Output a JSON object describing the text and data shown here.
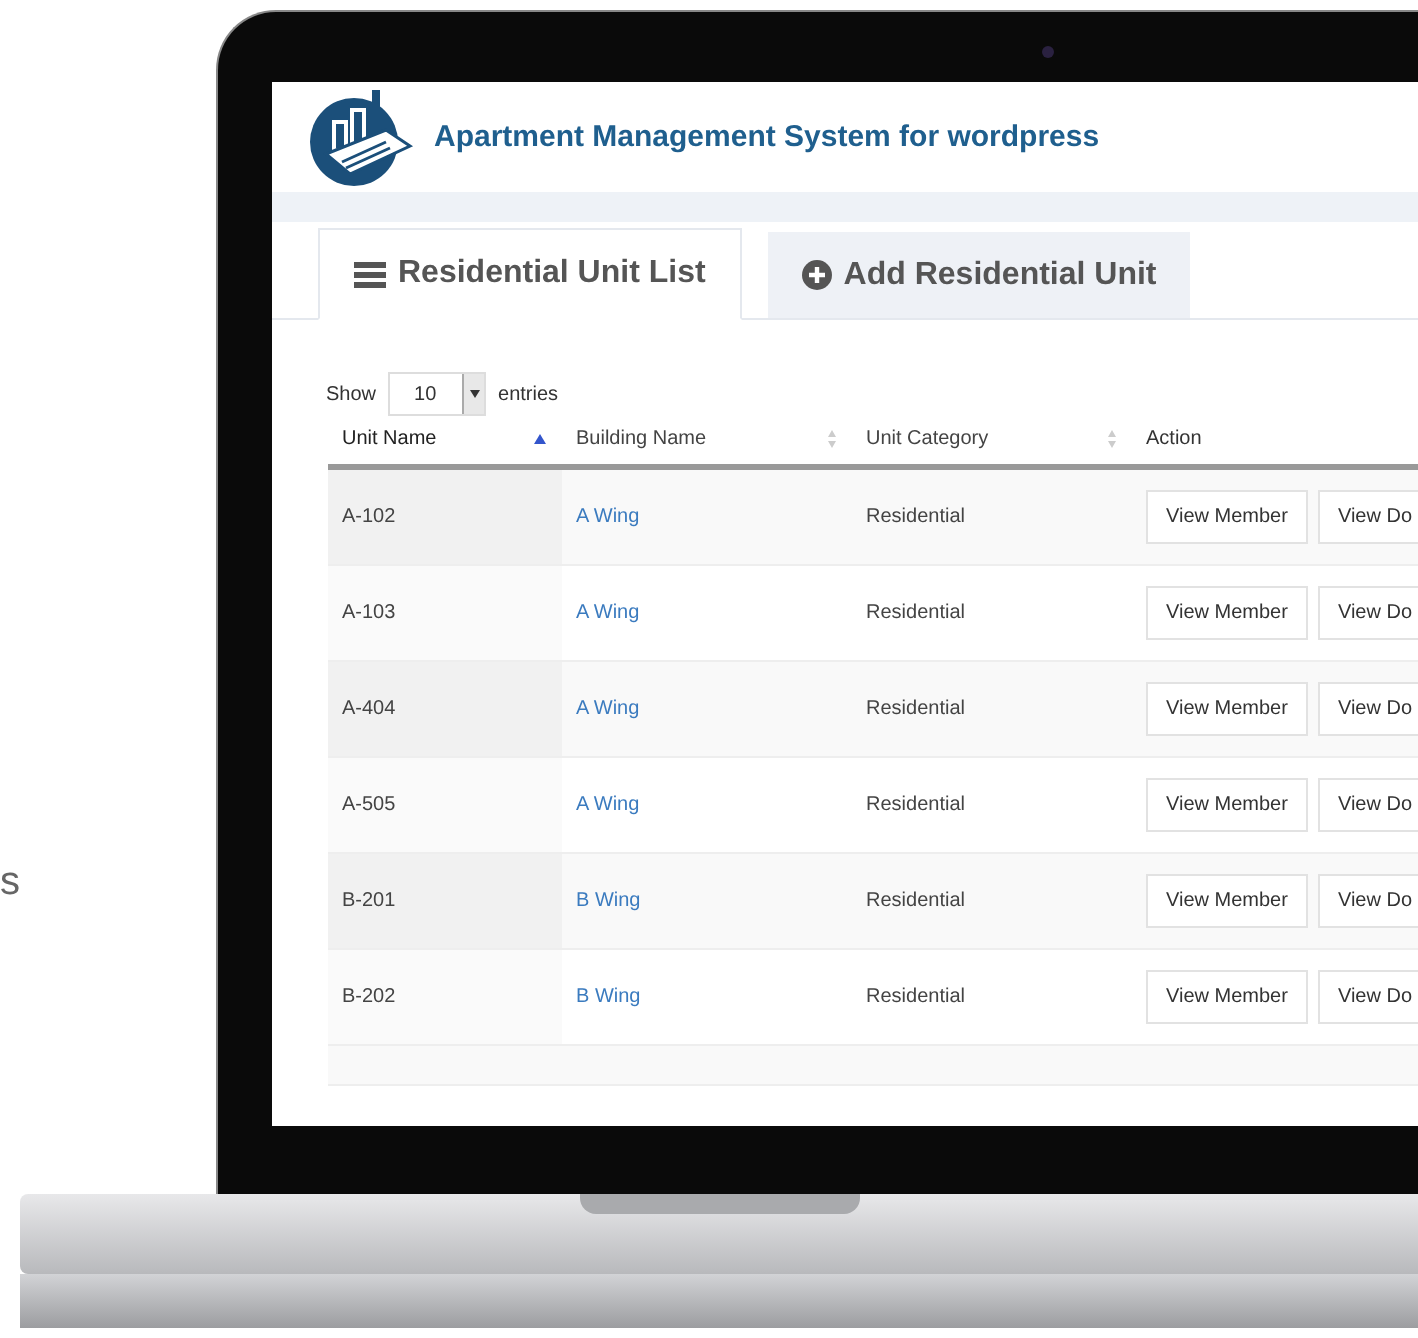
{
  "side_text": "s",
  "app": {
    "title": "Apartment Management System for wordpress"
  },
  "tabs": [
    {
      "label": "Residential Unit List",
      "kind": "list",
      "selected": true
    },
    {
      "label": "Add Residential Unit",
      "kind": "add",
      "selected": false
    }
  ],
  "length_control": {
    "prefix": "Show",
    "value": "10",
    "suffix": "entries"
  },
  "table": {
    "columns": [
      {
        "label": "Unit Name",
        "sortable": true,
        "sorted": true
      },
      {
        "label": "Building Name",
        "sortable": true,
        "sorted": false
      },
      {
        "label": "Unit Category",
        "sortable": true,
        "sorted": false
      },
      {
        "label": "Action",
        "sortable": false,
        "sorted": false
      }
    ],
    "rows": [
      {
        "unit_name": "A-102",
        "building_name": "A Wing",
        "unit_category": "Residential",
        "actions": [
          "View Member",
          "View Do"
        ]
      },
      {
        "unit_name": "A-103",
        "building_name": "A Wing",
        "unit_category": "Residential",
        "actions": [
          "View Member",
          "View Do"
        ]
      },
      {
        "unit_name": "A-404",
        "building_name": "A Wing",
        "unit_category": "Residential",
        "actions": [
          "View Member",
          "View Do"
        ]
      },
      {
        "unit_name": "A-505",
        "building_name": "A Wing",
        "unit_category": "Residential",
        "actions": [
          "View Member",
          "View Do"
        ]
      },
      {
        "unit_name": "B-201",
        "building_name": "B Wing",
        "unit_category": "Residential",
        "actions": [
          "View Member",
          "View Do"
        ]
      },
      {
        "unit_name": "B-202",
        "building_name": "B Wing",
        "unit_category": "Residential",
        "actions": [
          "View Member",
          "View Do"
        ]
      }
    ]
  }
}
